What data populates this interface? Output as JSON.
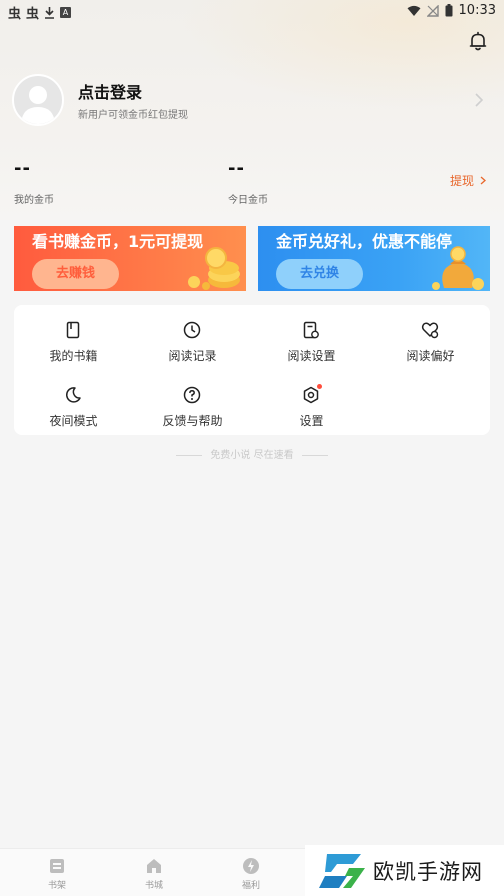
{
  "status_bar": {
    "time": "10:33",
    "left_glyphs": [
      "虫",
      "虫"
    ]
  },
  "profile": {
    "title": "点击登录",
    "subtitle": "新用户可领金币红包提现"
  },
  "coins": {
    "my_value": "--",
    "my_label": "我的金币",
    "today_value": "--",
    "today_label": "今日金币",
    "withdraw_label": "提现"
  },
  "banners": {
    "earn": {
      "title": "看书赚金币，1元可提现",
      "button": "去赚钱",
      "color": "#ff6a44"
    },
    "exchange": {
      "title": "金币兑好礼，优惠不能停",
      "button": "去兑换",
      "color": "#3a9cf3"
    }
  },
  "menu": [
    {
      "label": "我的书籍",
      "icon": "book-icon"
    },
    {
      "label": "阅读记录",
      "icon": "clock-icon"
    },
    {
      "label": "阅读设置",
      "icon": "reading-settings-icon"
    },
    {
      "label": "阅读偏好",
      "icon": "heart-icon"
    },
    {
      "label": "夜间模式",
      "icon": "moon-icon"
    },
    {
      "label": "反馈与帮助",
      "icon": "help-icon"
    },
    {
      "label": "设置",
      "icon": "settings-icon"
    }
  ],
  "slogan": "免费小说 尽在速看",
  "bottom_nav": [
    {
      "label": "书架",
      "icon": "bookshelf-icon"
    },
    {
      "label": "书城",
      "icon": "home-icon"
    },
    {
      "label": "福利",
      "icon": "bolt-icon"
    }
  ],
  "watermark": {
    "text": "欧凯手游网"
  },
  "colors": {
    "accent_orange": "#e8672c",
    "background": "#f5f5f5"
  }
}
